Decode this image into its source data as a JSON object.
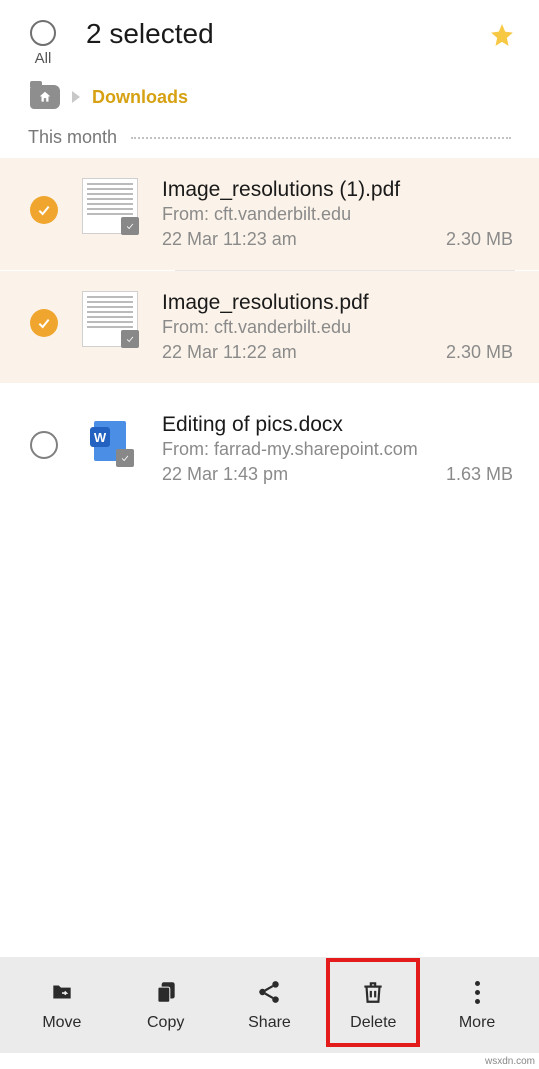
{
  "header": {
    "title": "2 selected",
    "all_label": "All"
  },
  "breadcrumb": {
    "current": "Downloads"
  },
  "section_label": "This month",
  "files": [
    {
      "name": "Image_resolutions (1).pdf",
      "source": "From: cft.vanderbilt.edu",
      "date": "22 Mar 11:23 am",
      "size": "2.30 MB",
      "selected": true,
      "type": "pdf"
    },
    {
      "name": "Image_resolutions.pdf",
      "source": "From: cft.vanderbilt.edu",
      "date": "22 Mar 11:22 am",
      "size": "2.30 MB",
      "selected": true,
      "type": "pdf"
    },
    {
      "name": "Editing of pics.docx",
      "source": "From: farrad-my.sharepoint.com",
      "date": "22 Mar 1:43 pm",
      "size": "1.63 MB",
      "selected": false,
      "type": "docx"
    }
  ],
  "actions": {
    "move": "Move",
    "copy": "Copy",
    "share": "Share",
    "delete": "Delete",
    "more": "More"
  },
  "watermark": "wsxdn.com"
}
